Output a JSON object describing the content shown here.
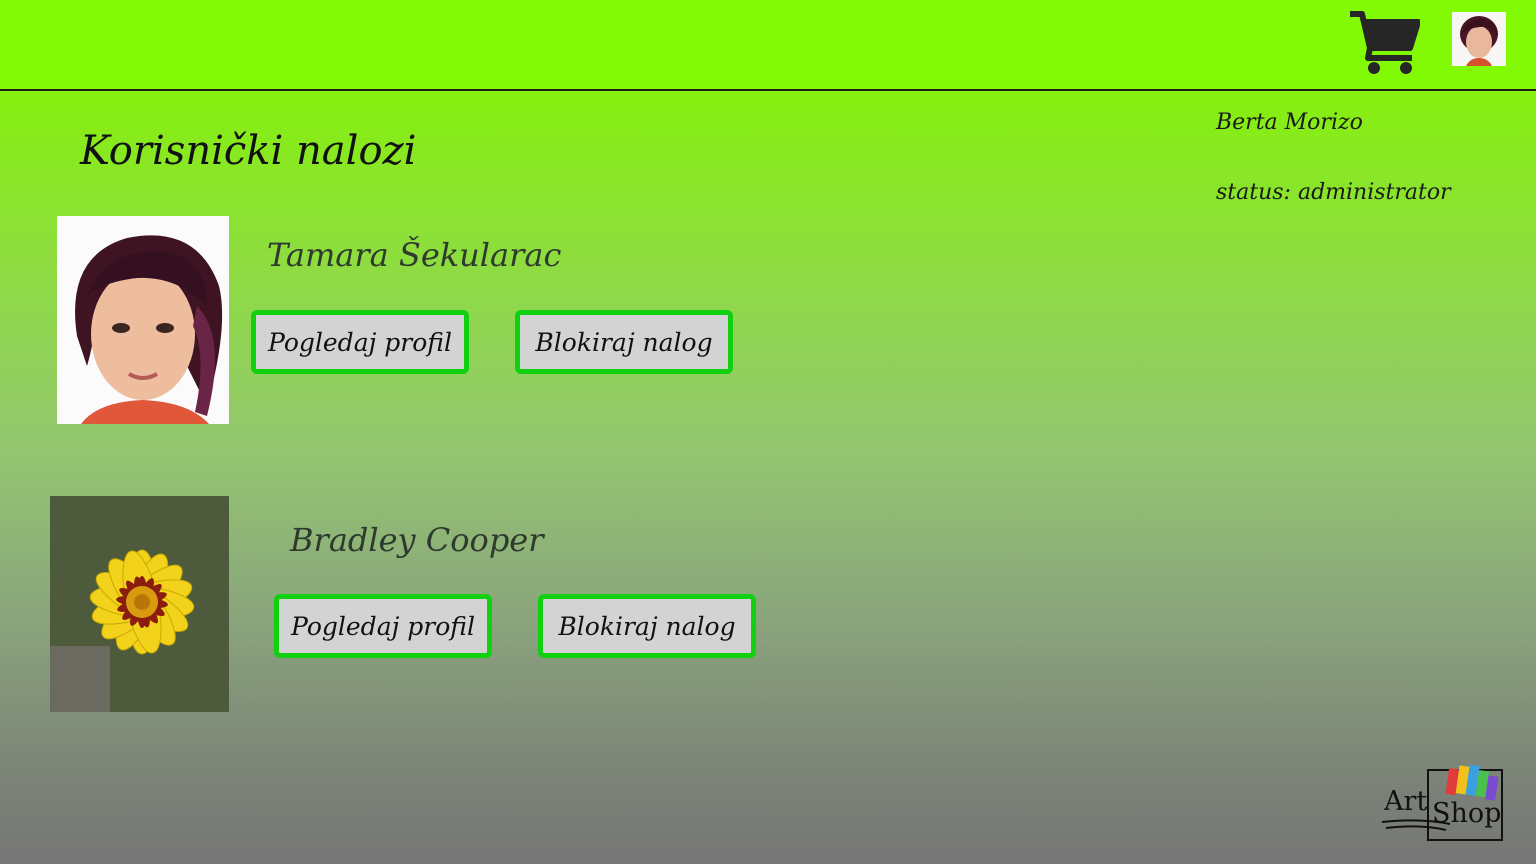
{
  "header": {
    "cart_icon": "shopping-cart-icon",
    "avatar_icon": "user-avatar"
  },
  "current_user": {
    "name": "Berta Morizo",
    "status": "status: administrator"
  },
  "page": {
    "title": "Korisnički nalozi"
  },
  "accounts": [
    {
      "name": "Tamara Šekularac",
      "photo": "portrait-photo",
      "view_label": "Pogledaj profil",
      "block_label": "Blokiraj nalog"
    },
    {
      "name": "Bradley Cooper",
      "photo": "yellow-flower-photo",
      "view_label": "Pogledaj profil",
      "block_label": "Blokiraj nalog"
    }
  ],
  "logo": {
    "word1": "Art",
    "word2": "Shop"
  },
  "colors": {
    "header_bg": "#82fa06",
    "button_border": "#10d010",
    "button_bg": "#d3d3d3"
  }
}
